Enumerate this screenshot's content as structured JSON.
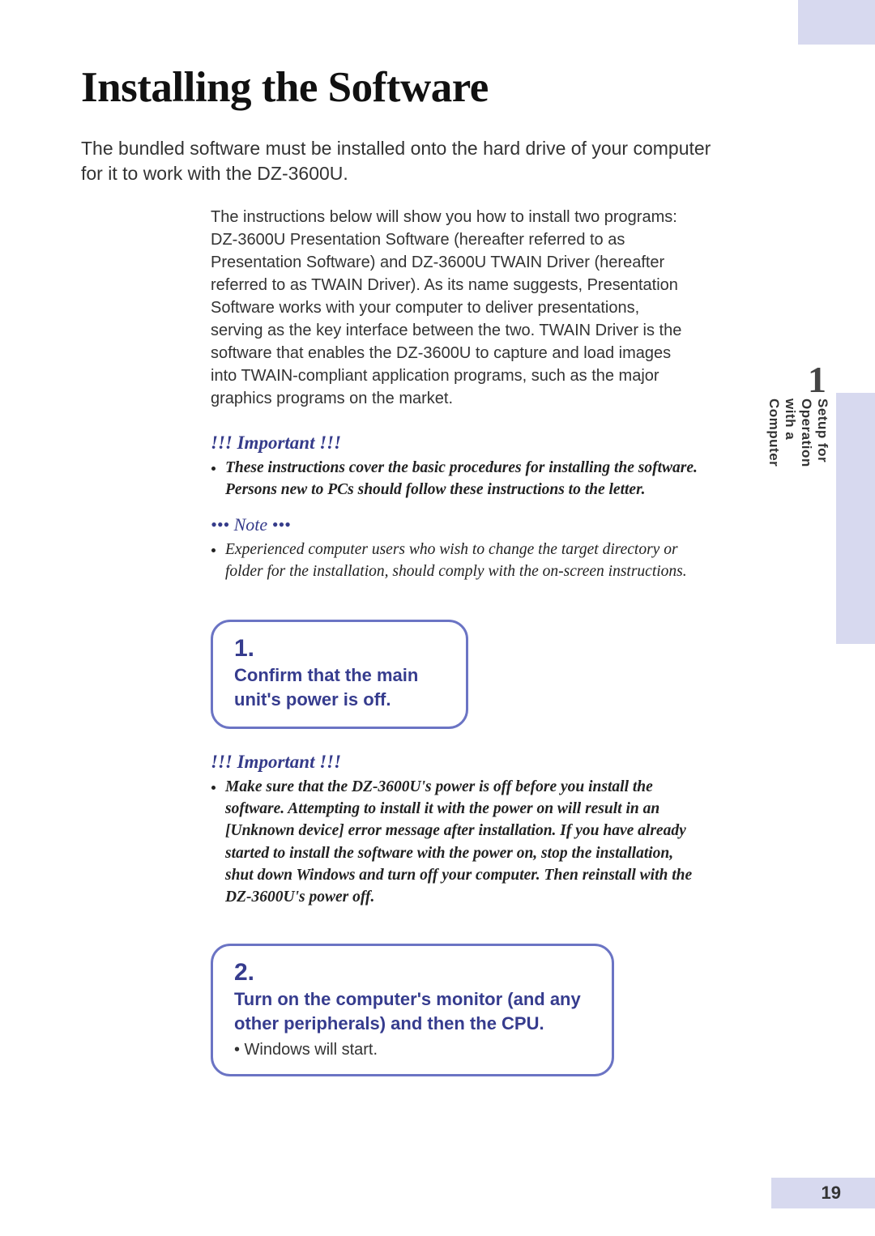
{
  "chapter": {
    "number": "1",
    "side_label": "Setup for Operation with a Computer"
  },
  "title": "Installing the Software",
  "lead": "The bundled software must be installed onto the hard drive of your computer for it to work with the DZ-3600U.",
  "body_intro": "The instructions below will show you how to install two programs: DZ-3600U Presentation Software (hereafter referred to as Presentation Software) and DZ-3600U TWAIN Driver (hereafter referred to as TWAIN Driver). As its name suggests, Presentation Software works with your computer to deliver presentations, serving as the key interface between the two. TWAIN Driver is the software that enables the DZ-3600U to capture and load images into TWAIN-compliant application programs, such as the major graphics programs on the market.",
  "important1": {
    "heading": "!!! Important !!!",
    "bullet": "These instructions cover the basic procedures for installing the software. Persons new to PCs should follow these instructions to the letter."
  },
  "note": {
    "heading": "••• Note •••",
    "bullet": "Experienced computer users who wish to change the target directory or folder for the installation, should comply with the on-screen instructions."
  },
  "step1": {
    "num": "1.",
    "text": "Confirm that the main unit's power is off."
  },
  "important2": {
    "heading": "!!! Important !!!",
    "bullet": "Make sure that the DZ-3600U's power is off before you install the software. Attempting to install it with the power on will result in an [Unknown device] error message after installation. If you have already started to install the software with the power on, stop the installation, shut down Windows and turn off your computer. Then reinstall with the DZ-3600U's power off."
  },
  "step2": {
    "num": "2.",
    "text": "Turn on the computer's monitor (and any other peripherals) and then the CPU.",
    "sub": "• Windows will start."
  },
  "page_number": "19"
}
